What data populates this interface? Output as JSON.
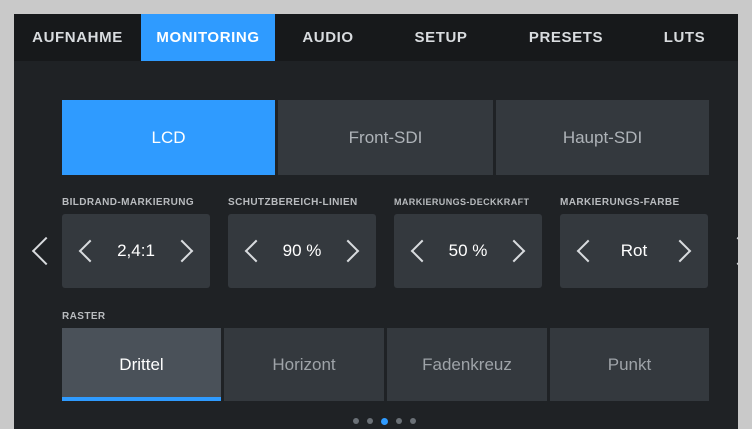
{
  "tabs": [
    {
      "label": "AUFNAHME",
      "active": false
    },
    {
      "label": "MONITORING",
      "active": true
    },
    {
      "label": "AUDIO",
      "active": false
    },
    {
      "label": "SETUP",
      "active": false
    },
    {
      "label": "PRESETS",
      "active": false
    },
    {
      "label": "LUTS",
      "active": false
    }
  ],
  "outputs": [
    {
      "label": "LCD",
      "active": true
    },
    {
      "label": "Front-SDI",
      "active": false
    },
    {
      "label": "Haupt-SDI",
      "active": false
    }
  ],
  "params": [
    {
      "label": "BILDRAND-MARKIERUNG",
      "value": "2,4:1"
    },
    {
      "label": "SCHUTZBEREICH-LINIEN",
      "value": "90 %"
    },
    {
      "label": "MARKIERUNGS-DECKKRAFT",
      "value": "50 %"
    },
    {
      "label": "MARKIERUNGS-FARBE",
      "value": "Rot"
    }
  ],
  "raster": {
    "label": "RASTER",
    "options": [
      {
        "label": "Drittel",
        "selected": true
      },
      {
        "label": "Horizont",
        "selected": false
      },
      {
        "label": "Fadenkreuz",
        "selected": false
      },
      {
        "label": "Punkt",
        "selected": false
      }
    ]
  },
  "pagination": {
    "total": 5,
    "current": 3
  },
  "colors": {
    "accent": "#2f9bff",
    "button": "#34393e",
    "background": "#1f2225"
  },
  "icons": [
    "chevron-left-icon",
    "chevron-right-icon"
  ]
}
